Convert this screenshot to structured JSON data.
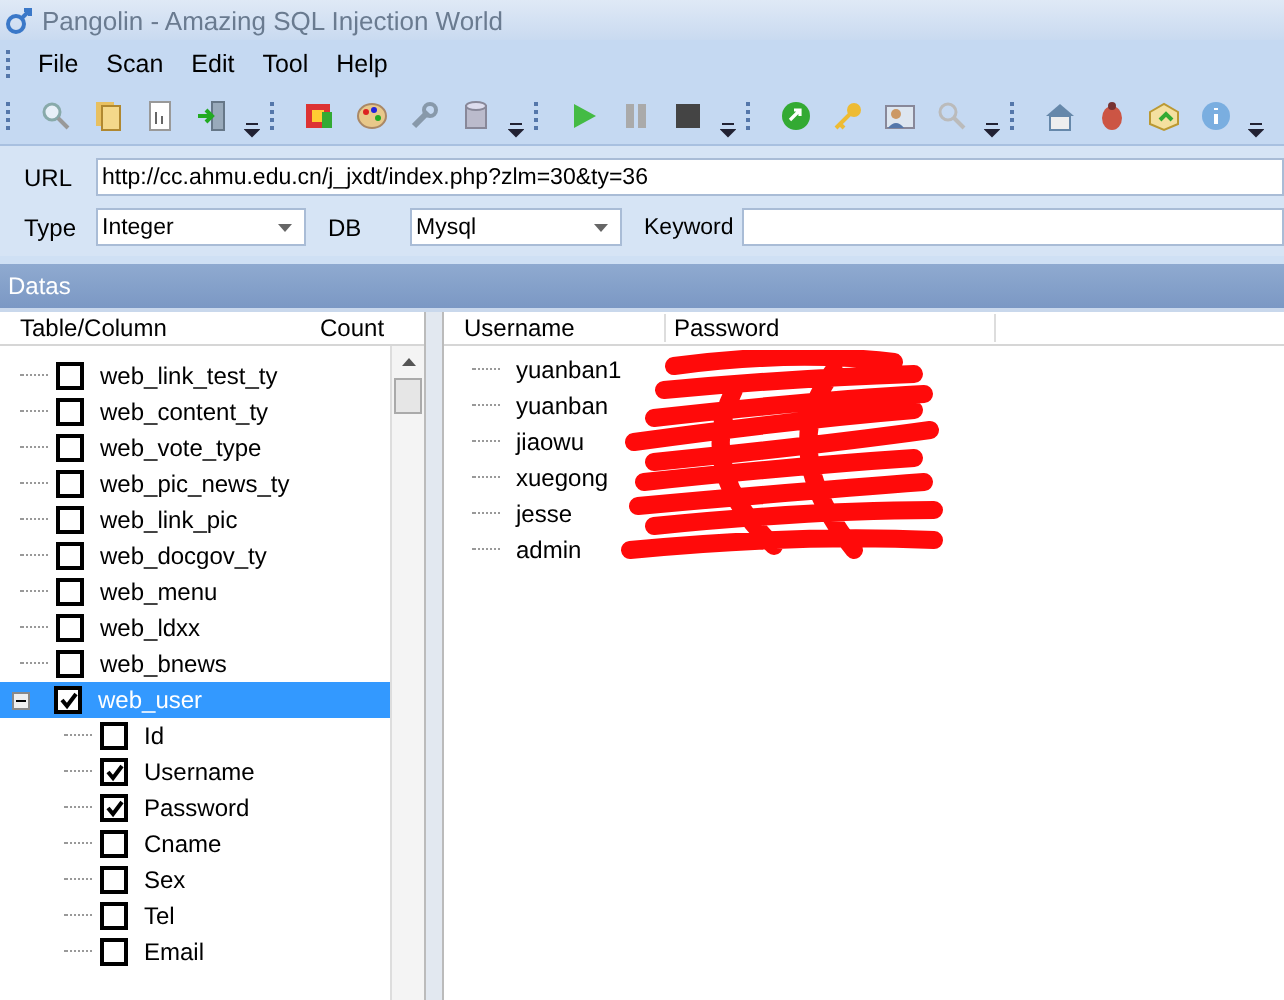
{
  "window": {
    "title": "Pangolin - Amazing SQL Injection World"
  },
  "menu": [
    "File",
    "Scan",
    "Edit",
    "Tool",
    "Help"
  ],
  "form": {
    "url_label": "URL",
    "url": "http://cc.ahmu.edu.cn/j_jxdt/index.php?zlm=30&ty=36",
    "type_label": "Type",
    "type": "Integer",
    "db_label": "DB",
    "db": "Mysql",
    "keyword_label": "Keyword"
  },
  "datas": {
    "title": "Datas"
  },
  "tree": {
    "columns": [
      "Table/Column",
      "Count"
    ],
    "items": [
      {
        "name": "web_link_test_ty",
        "checked": false,
        "selected": false
      },
      {
        "name": "web_content_ty",
        "checked": false,
        "selected": false
      },
      {
        "name": "web_vote_type",
        "checked": false,
        "selected": false
      },
      {
        "name": "web_pic_news_ty",
        "checked": false,
        "selected": false
      },
      {
        "name": "web_link_pic",
        "checked": false,
        "selected": false
      },
      {
        "name": "web_docgov_ty",
        "checked": false,
        "selected": false
      },
      {
        "name": "web_menu",
        "checked": false,
        "selected": false
      },
      {
        "name": "web_ldxx",
        "checked": false,
        "selected": false
      },
      {
        "name": "web_bnews",
        "checked": false,
        "selected": false
      },
      {
        "name": "web_user",
        "checked": true,
        "selected": true,
        "expanded": true,
        "children": [
          {
            "name": "Id",
            "checked": false,
            "selected": false
          },
          {
            "name": "Username",
            "checked": true,
            "selected": false
          },
          {
            "name": "Password",
            "checked": true,
            "selected": false
          },
          {
            "name": "Cname",
            "checked": false,
            "selected": false
          },
          {
            "name": "Sex",
            "checked": false,
            "selected": false
          },
          {
            "name": "Tel",
            "checked": false,
            "selected": false
          },
          {
            "name": "Email",
            "checked": false,
            "selected": false
          }
        ]
      }
    ]
  },
  "results": {
    "columns": [
      "Username",
      "Password"
    ],
    "rows": [
      {
        "username": "yuanban1"
      },
      {
        "username": "yuanban"
      },
      {
        "username": "jiaowu"
      },
      {
        "username": "xuegong"
      },
      {
        "username": "jesse"
      },
      {
        "username": "admin"
      }
    ]
  }
}
